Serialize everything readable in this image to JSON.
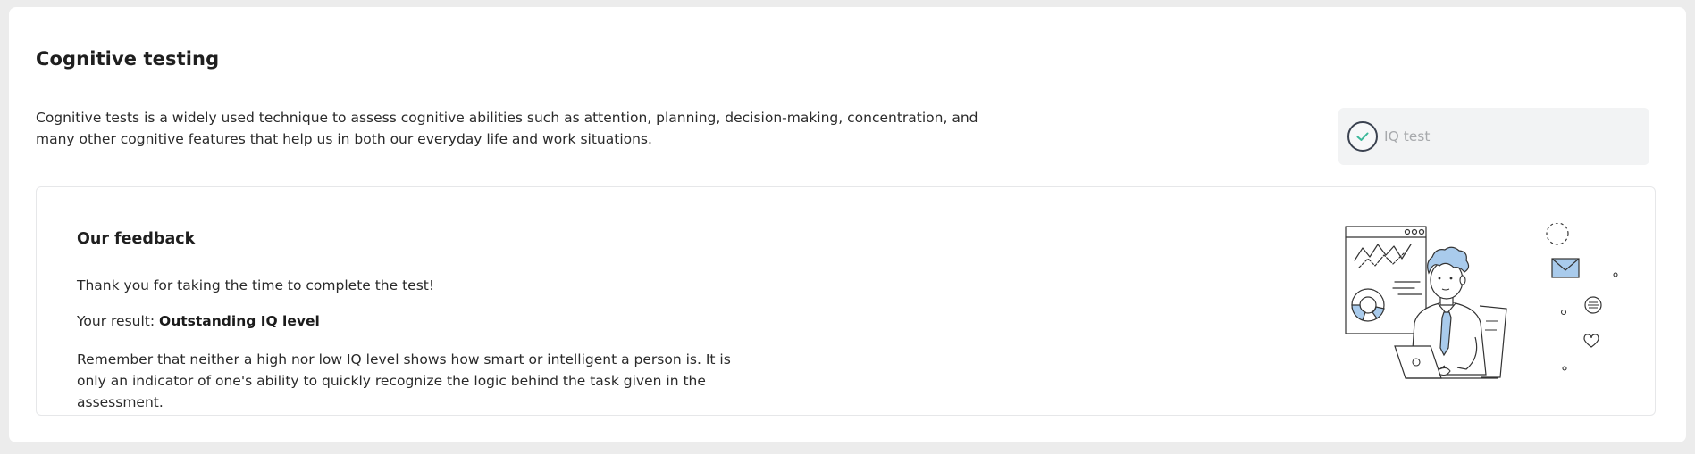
{
  "page": {
    "title": "Cognitive testing",
    "intro": "Cognitive tests is a widely used technique to assess cognitive abilities such as attention, planning, decision-making, concentration, and many other cognitive features that help us in both our everyday life and work situations."
  },
  "tests": {
    "items": [
      {
        "label": "IQ test",
        "status": "completed",
        "icon": "check-icon"
      }
    ]
  },
  "feedback": {
    "title": "Our feedback",
    "thanks": "Thank you for taking the time to complete the test!",
    "result_label": "Your result: ",
    "result_value": "Outstanding IQ level",
    "remember": "Remember that neither a high nor low IQ level shows how smart or intelligent a person is. It is only an indicator of one's ability to quickly recognize the logic behind the task given in the assessment.",
    "illustration_icon": "person-at-laptop-illustration"
  },
  "colors": {
    "accent": "#3bb89a",
    "illustration_fill": "#a9cbec",
    "panel_bg": "#ffffff",
    "page_bg": "#ececec"
  }
}
